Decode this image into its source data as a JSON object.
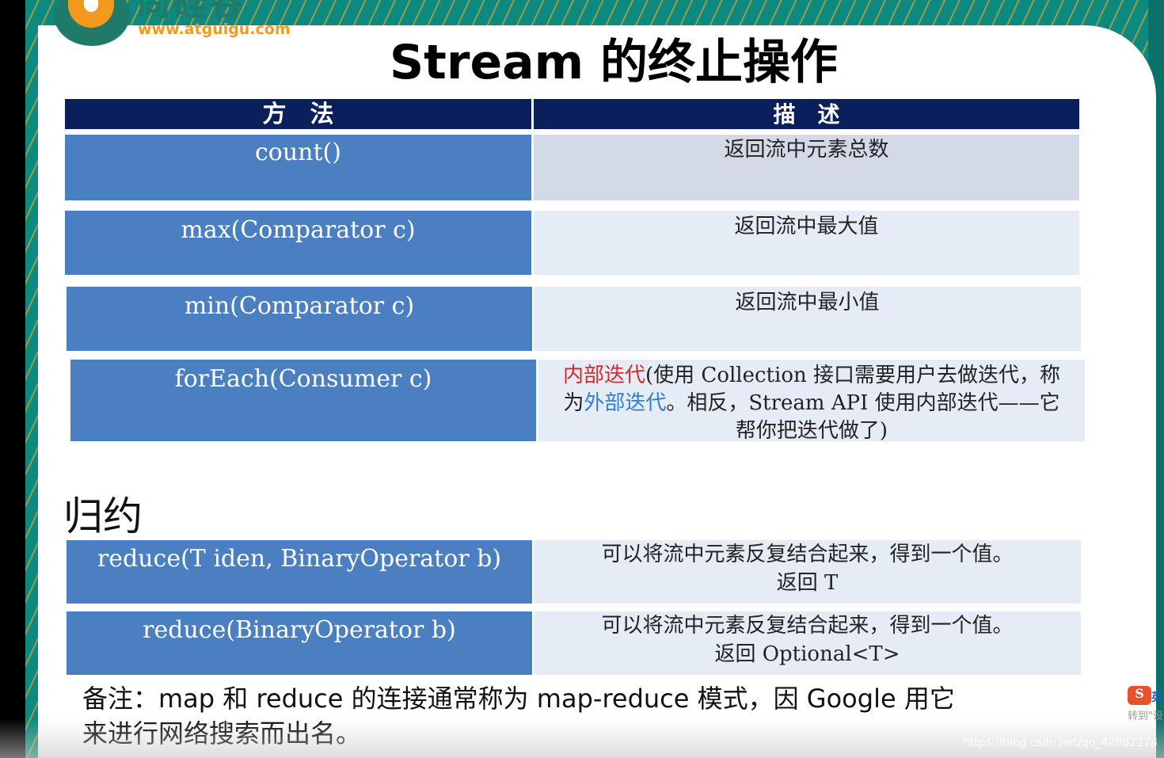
{
  "logo": {
    "cn": "尚硅谷",
    "url": "www.atguigu.com"
  },
  "title": "Stream 的终止操作",
  "table": {
    "headers": [
      "方　法",
      "描　述"
    ],
    "rows": [
      {
        "method": "count()",
        "desc": "返回流中元素总数"
      },
      {
        "method": "max(Comparator c)",
        "desc": "返回流中最大值"
      },
      {
        "method": "min(Comparator c)",
        "desc": "返回流中最小值"
      },
      {
        "method": "forEach(Consumer c)",
        "desc_parts": [
          "内部迭代",
          "(使用 Collection 接口需要用户去做迭代，称为",
          "外部迭代",
          "。相反，Stream API 使用内部迭代——它帮你把迭代做了)"
        ]
      }
    ]
  },
  "section": {
    "title": "归约"
  },
  "reduce_table": {
    "rows": [
      {
        "method": "reduce(T iden, BinaryOperator b)",
        "desc1": "可以将流中元素反复结合起来，得到一个值。",
        "desc2": "返回 T"
      },
      {
        "method": "reduce(BinaryOperator b)",
        "desc1": "可以将流中元素反复结合起来，得到一个值。",
        "desc2": "返回 Optional<T>"
      }
    ]
  },
  "note": {
    "line1": "备注：map 和 reduce 的连接通常称为 map-reduce 模式，因 Google 用它",
    "line2": "来进行网络搜索而出名。"
  },
  "watermark": "https://blog.csdn.net/qq_42082278",
  "ime": {
    "icon": "S",
    "lang": "英",
    "tip": "转到\"设"
  }
}
